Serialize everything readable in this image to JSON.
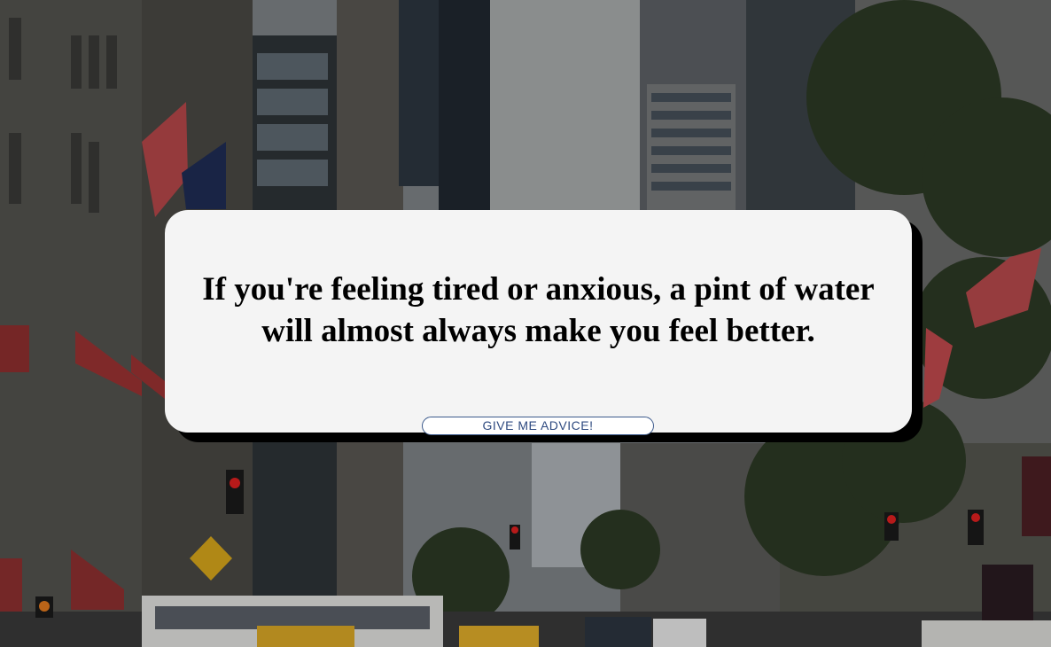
{
  "advice": {
    "text": "If you're feeling tired or anxious, a pint of water will almost always make you feel better."
  },
  "button": {
    "label": "GIVE ME ADVICE!"
  },
  "background": {
    "subject": "city-street-photo"
  },
  "colors": {
    "card": "#f4f4f4",
    "card_shadow": "#000000",
    "button_border": "#3c5a8c",
    "button_text": "#2e4a80"
  }
}
